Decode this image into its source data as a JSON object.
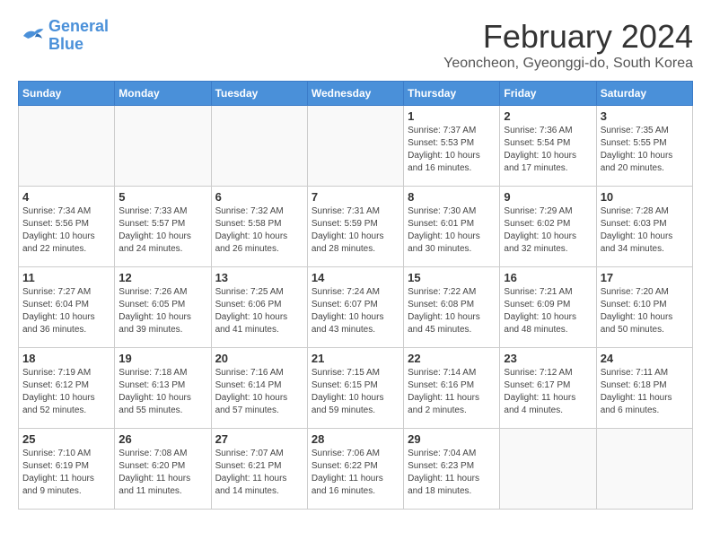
{
  "header": {
    "logo_line1": "General",
    "logo_line2": "Blue",
    "title": "February 2024",
    "location": "Yeoncheon, Gyeonggi-do, South Korea"
  },
  "weekdays": [
    "Sunday",
    "Monday",
    "Tuesday",
    "Wednesday",
    "Thursday",
    "Friday",
    "Saturday"
  ],
  "weeks": [
    [
      {
        "day": "",
        "info": ""
      },
      {
        "day": "",
        "info": ""
      },
      {
        "day": "",
        "info": ""
      },
      {
        "day": "",
        "info": ""
      },
      {
        "day": "1",
        "info": "Sunrise: 7:37 AM\nSunset: 5:53 PM\nDaylight: 10 hours\nand 16 minutes."
      },
      {
        "day": "2",
        "info": "Sunrise: 7:36 AM\nSunset: 5:54 PM\nDaylight: 10 hours\nand 17 minutes."
      },
      {
        "day": "3",
        "info": "Sunrise: 7:35 AM\nSunset: 5:55 PM\nDaylight: 10 hours\nand 20 minutes."
      }
    ],
    [
      {
        "day": "4",
        "info": "Sunrise: 7:34 AM\nSunset: 5:56 PM\nDaylight: 10 hours\nand 22 minutes."
      },
      {
        "day": "5",
        "info": "Sunrise: 7:33 AM\nSunset: 5:57 PM\nDaylight: 10 hours\nand 24 minutes."
      },
      {
        "day": "6",
        "info": "Sunrise: 7:32 AM\nSunset: 5:58 PM\nDaylight: 10 hours\nand 26 minutes."
      },
      {
        "day": "7",
        "info": "Sunrise: 7:31 AM\nSunset: 5:59 PM\nDaylight: 10 hours\nand 28 minutes."
      },
      {
        "day": "8",
        "info": "Sunrise: 7:30 AM\nSunset: 6:01 PM\nDaylight: 10 hours\nand 30 minutes."
      },
      {
        "day": "9",
        "info": "Sunrise: 7:29 AM\nSunset: 6:02 PM\nDaylight: 10 hours\nand 32 minutes."
      },
      {
        "day": "10",
        "info": "Sunrise: 7:28 AM\nSunset: 6:03 PM\nDaylight: 10 hours\nand 34 minutes."
      }
    ],
    [
      {
        "day": "11",
        "info": "Sunrise: 7:27 AM\nSunset: 6:04 PM\nDaylight: 10 hours\nand 36 minutes."
      },
      {
        "day": "12",
        "info": "Sunrise: 7:26 AM\nSunset: 6:05 PM\nDaylight: 10 hours\nand 39 minutes."
      },
      {
        "day": "13",
        "info": "Sunrise: 7:25 AM\nSunset: 6:06 PM\nDaylight: 10 hours\nand 41 minutes."
      },
      {
        "day": "14",
        "info": "Sunrise: 7:24 AM\nSunset: 6:07 PM\nDaylight: 10 hours\nand 43 minutes."
      },
      {
        "day": "15",
        "info": "Sunrise: 7:22 AM\nSunset: 6:08 PM\nDaylight: 10 hours\nand 45 minutes."
      },
      {
        "day": "16",
        "info": "Sunrise: 7:21 AM\nSunset: 6:09 PM\nDaylight: 10 hours\nand 48 minutes."
      },
      {
        "day": "17",
        "info": "Sunrise: 7:20 AM\nSunset: 6:10 PM\nDaylight: 10 hours\nand 50 minutes."
      }
    ],
    [
      {
        "day": "18",
        "info": "Sunrise: 7:19 AM\nSunset: 6:12 PM\nDaylight: 10 hours\nand 52 minutes."
      },
      {
        "day": "19",
        "info": "Sunrise: 7:18 AM\nSunset: 6:13 PM\nDaylight: 10 hours\nand 55 minutes."
      },
      {
        "day": "20",
        "info": "Sunrise: 7:16 AM\nSunset: 6:14 PM\nDaylight: 10 hours\nand 57 minutes."
      },
      {
        "day": "21",
        "info": "Sunrise: 7:15 AM\nSunset: 6:15 PM\nDaylight: 10 hours\nand 59 minutes."
      },
      {
        "day": "22",
        "info": "Sunrise: 7:14 AM\nSunset: 6:16 PM\nDaylight: 11 hours\nand 2 minutes."
      },
      {
        "day": "23",
        "info": "Sunrise: 7:12 AM\nSunset: 6:17 PM\nDaylight: 11 hours\nand 4 minutes."
      },
      {
        "day": "24",
        "info": "Sunrise: 7:11 AM\nSunset: 6:18 PM\nDaylight: 11 hours\nand 6 minutes."
      }
    ],
    [
      {
        "day": "25",
        "info": "Sunrise: 7:10 AM\nSunset: 6:19 PM\nDaylight: 11 hours\nand 9 minutes."
      },
      {
        "day": "26",
        "info": "Sunrise: 7:08 AM\nSunset: 6:20 PM\nDaylight: 11 hours\nand 11 minutes."
      },
      {
        "day": "27",
        "info": "Sunrise: 7:07 AM\nSunset: 6:21 PM\nDaylight: 11 hours\nand 14 minutes."
      },
      {
        "day": "28",
        "info": "Sunrise: 7:06 AM\nSunset: 6:22 PM\nDaylight: 11 hours\nand 16 minutes."
      },
      {
        "day": "29",
        "info": "Sunrise: 7:04 AM\nSunset: 6:23 PM\nDaylight: 11 hours\nand 18 minutes."
      },
      {
        "day": "",
        "info": ""
      },
      {
        "day": "",
        "info": ""
      }
    ]
  ]
}
